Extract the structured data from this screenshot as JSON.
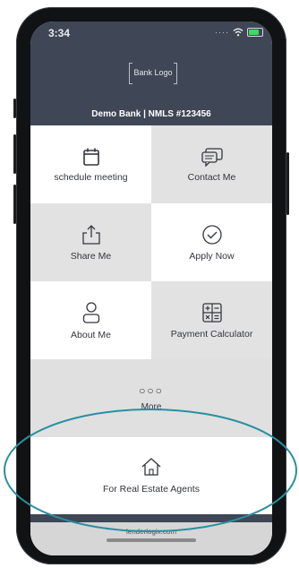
{
  "status": {
    "time": "3:34"
  },
  "header": {
    "logo_text": "Bank Logo",
    "bank_line": "Demo Bank | NMLS #123456"
  },
  "tiles": [
    {
      "label": "schedule meeting",
      "icon": "calendar-icon"
    },
    {
      "label": "Contact Me",
      "icon": "chat-icon"
    },
    {
      "label": "Share Me",
      "icon": "share-icon"
    },
    {
      "label": "Apply Now",
      "icon": "check-circle-icon"
    },
    {
      "label": "About Me",
      "icon": "person-icon"
    },
    {
      "label": "Payment Calculator",
      "icon": "calculator-icon"
    }
  ],
  "more": {
    "label": "More",
    "icon": "ellipsis-icon"
  },
  "agents": {
    "label": "For Real Estate Agents",
    "icon": "house-icon"
  },
  "footer": {
    "text": "lenderlogix.com"
  },
  "colors": {
    "header": "#3f4756",
    "highlight": "#2a8fa0"
  }
}
